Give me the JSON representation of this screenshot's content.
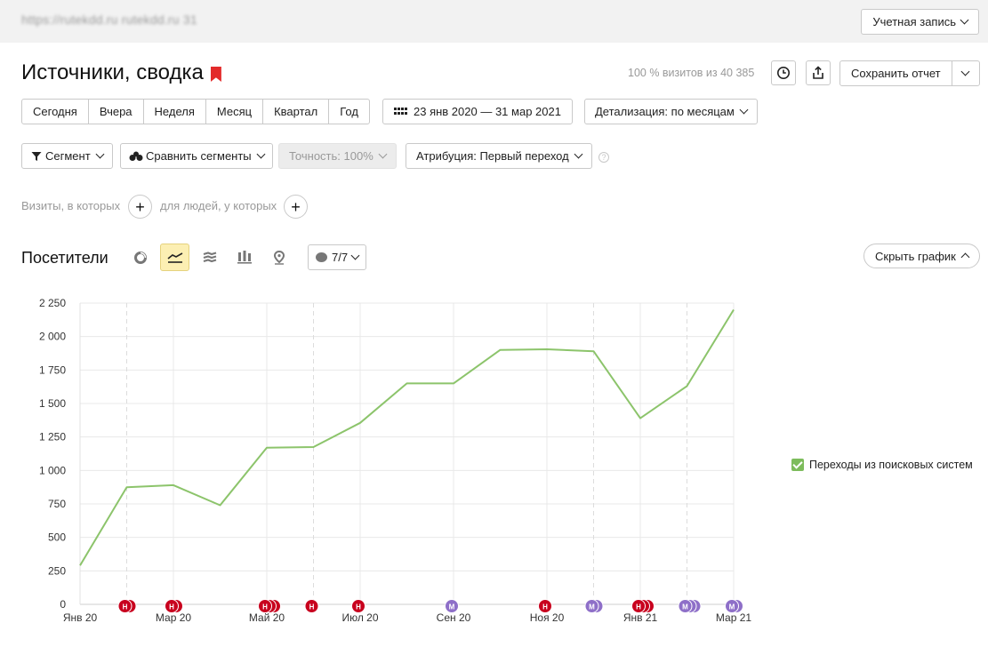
{
  "topbar": {
    "url": "https://rutekdd.ru    rutekdd.ru   31",
    "account_label": "Учетная запись"
  },
  "header": {
    "title": "Источники, сводка",
    "visits_info": "100 % визитов из 40 385",
    "save_label": "Сохранить отчет"
  },
  "periods": [
    "Сегодня",
    "Вчера",
    "Неделя",
    "Месяц",
    "Квартал",
    "Год"
  ],
  "date_range": "23 янв 2020 — 31 мар 2021",
  "detail_label": "Детализация: по месяцам",
  "filters": {
    "segment": "Сегмент",
    "compare": "Сравнить сегменты",
    "accuracy": "Точность: 100%",
    "attribution": "Атрибуция: Первый переход",
    "help": "?"
  },
  "conditions": {
    "visits_label": "Визиты, в которых",
    "people_label": "для людей, у которых",
    "plus": "+"
  },
  "chart_section": {
    "title": "Посетители",
    "notes_label": "7/7",
    "hide_chart_label": "Скрыть график"
  },
  "colors": {
    "line": "#8cc46b",
    "note_red": "#c8001e",
    "note_purple": "#8e6fc8",
    "active_view": "#fcefb3"
  },
  "chart_data": {
    "type": "line",
    "series": [
      {
        "name": "Переходы из поисковых систем",
        "values": [
          290,
          875,
          890,
          740,
          1170,
          1175,
          1355,
          1650,
          1650,
          1900,
          1905,
          1890,
          1390,
          1630,
          2200
        ]
      }
    ],
    "x_ticks": [
      {
        "index": 0,
        "label": "Янв 20"
      },
      {
        "index": 2,
        "label": "Мар 20"
      },
      {
        "index": 4,
        "label": "Май 20"
      },
      {
        "index": 6,
        "label": "Июл 20"
      },
      {
        "index": 8,
        "label": "Сен 20"
      },
      {
        "index": 10,
        "label": "Ноя 20"
      },
      {
        "index": 12,
        "label": "Янв 21"
      },
      {
        "index": 14,
        "label": "Мар 21"
      }
    ],
    "y_ticks": [
      "0",
      "250",
      "500",
      "750",
      "1 000",
      "1 250",
      "1 500",
      "1 750",
      "2 000",
      "2 250"
    ],
    "ylim": [
      0,
      2250
    ],
    "grid": true,
    "legend_position": "right",
    "notes": [
      {
        "index": 1,
        "letter": "Н",
        "color": "red",
        "count": 2
      },
      {
        "index": 2,
        "letter": "Н",
        "color": "red",
        "count": 2
      },
      {
        "index": 4,
        "letter": "Н",
        "color": "red",
        "count": 3
      },
      {
        "index": 5,
        "letter": "Н",
        "color": "red",
        "count": 1
      },
      {
        "index": 6,
        "letter": "Н",
        "color": "red",
        "count": 1
      },
      {
        "index": 8,
        "letter": "М",
        "color": "purple",
        "count": 1
      },
      {
        "index": 10,
        "letter": "Н",
        "color": "red",
        "count": 1
      },
      {
        "index": 11,
        "letter": "М",
        "color": "purple",
        "count": 2
      },
      {
        "index": 12,
        "letter": "Н",
        "color": "red",
        "count": 3
      },
      {
        "index": 13,
        "letter": "М",
        "color": "purple",
        "count": 3
      },
      {
        "index": 14,
        "letter": "М",
        "color": "purple",
        "count": 2
      }
    ]
  }
}
